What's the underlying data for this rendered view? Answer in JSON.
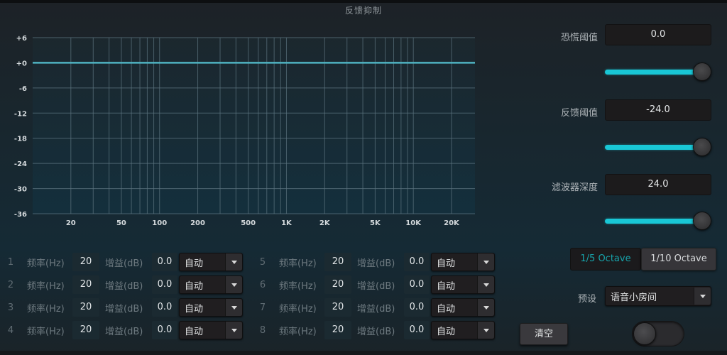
{
  "window": {
    "title": "反馈抑制"
  },
  "chart_data": {
    "type": "line",
    "title": "",
    "xlabel": "",
    "ylabel": "",
    "x_scale": "log",
    "xlim": [
      10,
      30600
    ],
    "ylim": [
      -36,
      6
    ],
    "grid": true,
    "y_ticks": [
      6,
      0,
      -6,
      -12,
      -18,
      -24,
      -30,
      -36
    ],
    "y_tick_labels": [
      "+6",
      "+0",
      "-6",
      "-12",
      "-18",
      "-24",
      "-30",
      "-36"
    ],
    "x_ticks": [
      20,
      50,
      100,
      200,
      500,
      1000,
      2000,
      5000,
      10000,
      20000
    ],
    "x_tick_labels": [
      "20",
      "50",
      "100",
      "200",
      "500",
      "1K",
      "2K",
      "5K",
      "10K",
      "20K"
    ],
    "x_gridlines": [
      20,
      30,
      40,
      50,
      60,
      70,
      80,
      90,
      100,
      200,
      300,
      400,
      500,
      600,
      700,
      800,
      900,
      1000,
      2000,
      3000,
      4000,
      5000,
      6000,
      7000,
      8000,
      9000,
      10000,
      20000
    ],
    "series": [
      {
        "name": "response",
        "color": "#4fb3c2",
        "x": [
          10,
          30600
        ],
        "y": [
          0,
          0
        ]
      }
    ]
  },
  "bands": [
    {
      "index": "1",
      "freq_label": "频率(Hz)",
      "freq": "20",
      "gain_label": "增益(dB)",
      "gain": "0.0",
      "mode": "自动"
    },
    {
      "index": "2",
      "freq_label": "频率(Hz)",
      "freq": "20",
      "gain_label": "增益(dB)",
      "gain": "0.0",
      "mode": "自动"
    },
    {
      "index": "3",
      "freq_label": "频率(Hz)",
      "freq": "20",
      "gain_label": "增益(dB)",
      "gain": "0.0",
      "mode": "自动"
    },
    {
      "index": "4",
      "freq_label": "频率(Hz)",
      "freq": "20",
      "gain_label": "增益(dB)",
      "gain": "0.0",
      "mode": "自动"
    },
    {
      "index": "5",
      "freq_label": "频率(Hz)",
      "freq": "20",
      "gain_label": "增益(dB)",
      "gain": "0.0",
      "mode": "自动"
    },
    {
      "index": "6",
      "freq_label": "频率(Hz)",
      "freq": "20",
      "gain_label": "增益(dB)",
      "gain": "0.0",
      "mode": "自动"
    },
    {
      "index": "7",
      "freq_label": "频率(Hz)",
      "freq": "20",
      "gain_label": "增益(dB)",
      "gain": "0.0",
      "mode": "自动"
    },
    {
      "index": "8",
      "freq_label": "频率(Hz)",
      "freq": "20",
      "gain_label": "增益(dB)",
      "gain": "0.0",
      "mode": "自动"
    }
  ],
  "right_panel": {
    "panic_threshold": {
      "label": "恐慌阈值",
      "value": "0.0",
      "slider_fraction": 1.0
    },
    "feedback_threshold": {
      "label": "反馈阈值",
      "value": "-24.0",
      "slider_fraction": 1.0
    },
    "filter_depth": {
      "label": "滤波器深度",
      "value": "24.0",
      "slider_fraction": 1.0
    },
    "octave_options": [
      {
        "label": "1/5 Octave",
        "selected": true
      },
      {
        "label": "1/10 Octave",
        "selected": false
      }
    ],
    "preset": {
      "label": "预设",
      "value": "语音小房间"
    },
    "clear_button": "清空",
    "enable_toggle": {
      "on": false
    }
  },
  "colors": {
    "accent": "#19c7d6",
    "curve": "#4fb3c2",
    "active_octave_text": "#17a3ab"
  }
}
